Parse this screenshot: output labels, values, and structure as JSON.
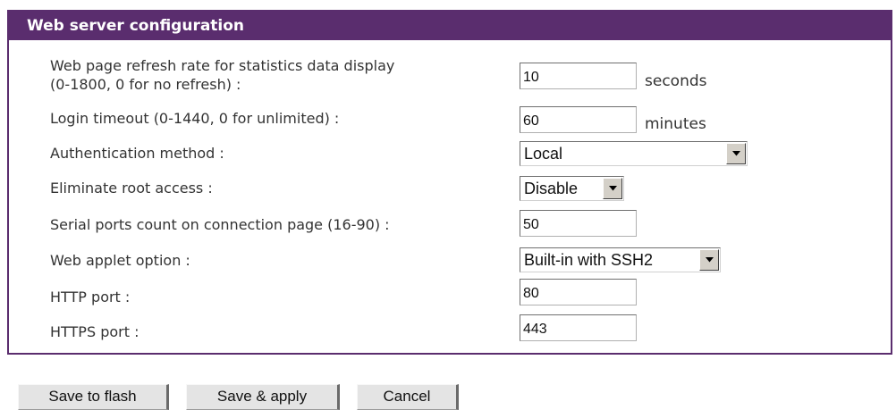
{
  "panel": {
    "title": "Web server configuration"
  },
  "fields": {
    "refresh_rate": {
      "label_line1": "Web page refresh rate for statistics data display",
      "label_line2": "(0-1800, 0 for no refresh) :",
      "value": "10",
      "unit": "seconds"
    },
    "login_timeout": {
      "label": "Login timeout (0-1440, 0 for unlimited) :",
      "value": "60",
      "unit": "minutes"
    },
    "auth_method": {
      "label": "Authentication method :",
      "value": "Local"
    },
    "eliminate_root": {
      "label": "Eliminate root access :",
      "value": "Disable"
    },
    "serial_ports_count": {
      "label": "Serial ports count on connection page (16-90) :",
      "value": "50"
    },
    "web_applet": {
      "label": "Web applet option :",
      "value": "Built-in with SSH2"
    },
    "http_port": {
      "label": "HTTP port :",
      "value": "80"
    },
    "https_port": {
      "label": "HTTPS port :",
      "value": "443"
    }
  },
  "buttons": {
    "save_flash": "Save to flash",
    "save_apply": "Save & apply",
    "cancel": "Cancel"
  },
  "colors": {
    "header_bg": "#5a2d6e",
    "header_text": "#ffffff"
  },
  "icons": {
    "dropdown": "chevron-down-icon"
  }
}
